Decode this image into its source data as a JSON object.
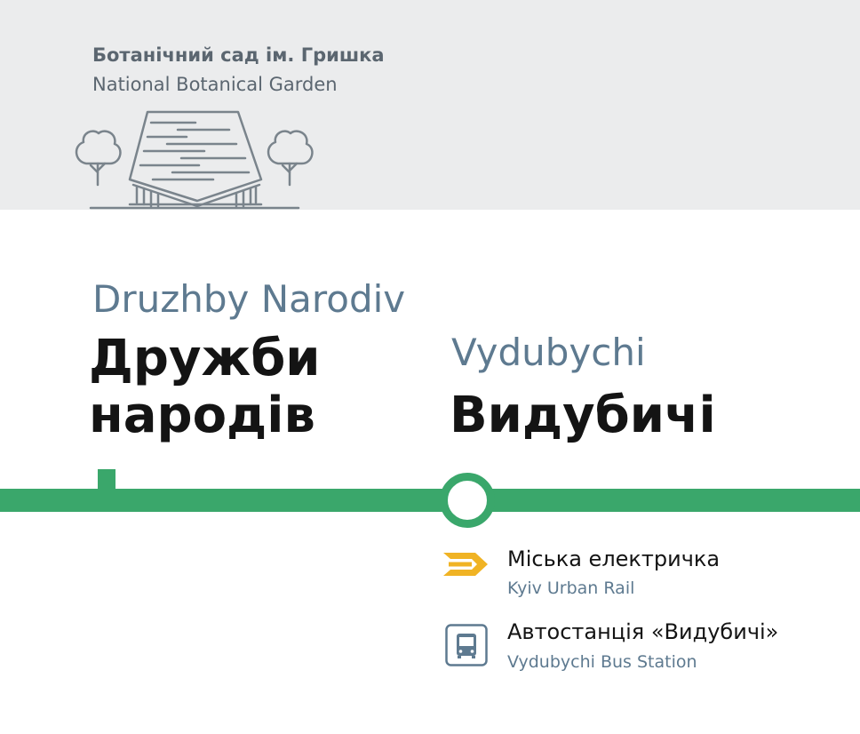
{
  "landmark": {
    "name_ua": "Ботанічний сад ім. Гришка",
    "name_en": "National Botanical Garden",
    "icon": "botanical-garden-building-illustration"
  },
  "stations": [
    {
      "name_en": "Druzhby Narodiv",
      "name_ua_line1": "Дружби",
      "name_ua_line2": "народів"
    },
    {
      "name_en": "Vydubychi",
      "name_ua": "Видубичі",
      "marker": "current-station-circle"
    }
  ],
  "line_color": "#3aa76b",
  "transfers": [
    {
      "icon": "urban-rail-icon",
      "icon_color": "#f0b324",
      "name_ua": "Міська електричка",
      "name_en": "Kyiv Urban Rail"
    },
    {
      "icon": "bus-icon",
      "icon_color": "#5e7a90",
      "name_ua": "Автостанція «Видубичі»",
      "name_en": "Vydubychi Bus Station"
    }
  ]
}
